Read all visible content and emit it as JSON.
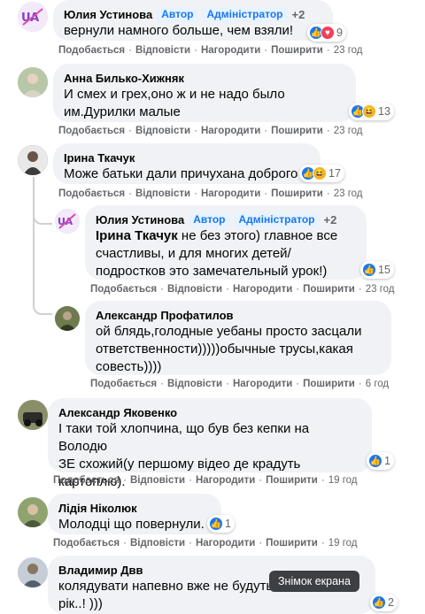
{
  "labels": {
    "like": "Подобається",
    "reply": "Відповісти",
    "award": "Нагородити",
    "share": "Поширити",
    "dot": "·"
  },
  "comments": [
    {
      "author": "Юлия Устинова",
      "badge_author": "Автор",
      "badge_admin": "Адміністратор",
      "plus": "+2",
      "text": "вернули намного больше, чем взяли!",
      "reactions": [
        "like-icon",
        "love-icon"
      ],
      "count": "9",
      "time": "23 год"
    },
    {
      "author": "Анна Билько-Хижняк",
      "text": "И смех и грех,оно ж и не надо было\nим.Дурилки малые",
      "reactions": [
        "like-icon",
        "haha-icon"
      ],
      "count": "13",
      "time": "23 год"
    },
    {
      "author": "Ірина Ткачук",
      "text": "Може батьки дали причухана доброго",
      "reactions": [
        "like-icon",
        "haha-icon"
      ],
      "count": "17",
      "time": "23 год"
    },
    {
      "author": "Юлия Устинова",
      "badge_author": "Автор",
      "badge_admin": "Адміністратор",
      "plus": "+2",
      "mention": "Ірина Ткачук",
      "text": " не без этого) главное все\nсчастливы, и для многих детей/\nподростков это замечательный урок!)",
      "reactions": [
        "like-icon"
      ],
      "count": "15",
      "time": "23 год"
    },
    {
      "author": "Александр Профатилов",
      "text": "ой блядь,голодные уебаны просто засцали\nответственности)))))обычные трусы,какая\nсовесть))))",
      "time": "6 год"
    },
    {
      "author": "Александр Яковенко",
      "text": "І таки той хлопчина, що був без кепки на Володю\nЗЕ схожий(у першому відео де крадуть\nкартоплю).",
      "reactions": [
        "like-icon"
      ],
      "count": "1",
      "time": "19 год"
    },
    {
      "author": "Лідія Ніколюк",
      "text": "Молодці що повернули.",
      "reactions": [
        "like-icon"
      ],
      "count": "1",
      "time": "19 год"
    },
    {
      "author": "Владимир Двв",
      "text": "колядувати напевно вже не будуть\nрік..! )))",
      "reactions": [
        "like-icon"
      ],
      "count": "2"
    }
  ],
  "tooltip": "Знімок екрана"
}
